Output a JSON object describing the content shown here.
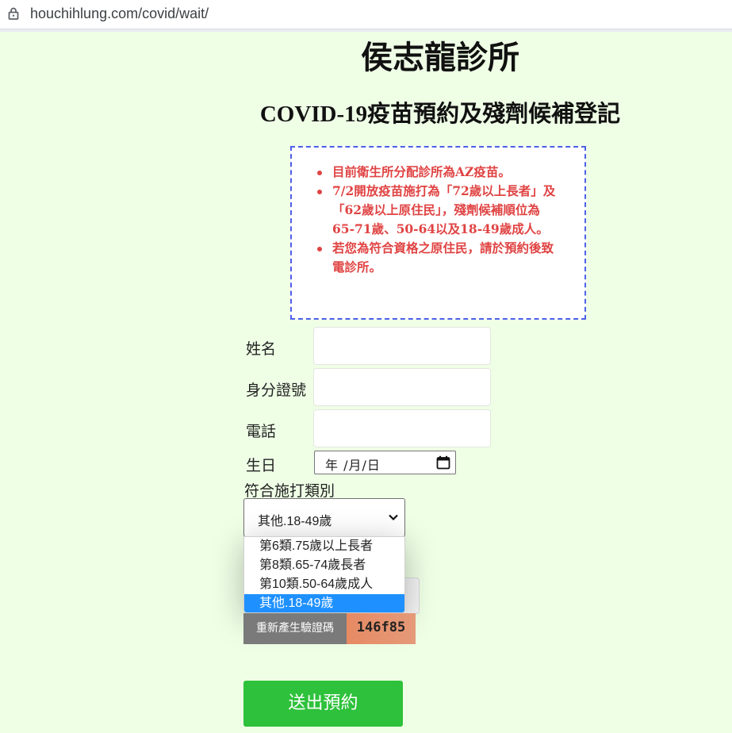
{
  "browser": {
    "url": "houchihlung.com/covid/wait/"
  },
  "header": {
    "clinic_name": "侯志龍診所",
    "subtitle": "COVID-19疫苗預約及殘劑候補登記"
  },
  "notice": {
    "items": [
      "目前衛生所分配診所為AZ疫苗。",
      "7/2開放疫苗施打為「72歲以上長者」及「62歲以上原住民」，殘劑候補順位為65-71歲、50-64以及18-49歲成人。",
      "若您為符合資格之原住民，請於預約後致電診所。"
    ]
  },
  "form": {
    "name_label": "姓名",
    "id_label": "身分證號",
    "phone_label": "電話",
    "birthday_label": "生日",
    "birthday_placeholder": "年 /月/日",
    "category_label": "符合施打類別",
    "category_selected": "其他.18-49歲",
    "category_options": [
      "第6類.75歲以上長者",
      "第8類.65-74歲長者",
      "第10類.50-64歲成人",
      "其他.18-49歲"
    ],
    "regenerate_captcha_label": "重新產生驗證碼",
    "captcha_code": "146f85",
    "submit_label": "送出預約"
  },
  "colors": {
    "page_background": "#efffe6",
    "notice_text": "#e04343",
    "notice_border": "#4d60e8",
    "submit_button": "#2ec13b",
    "selected_option": "#1e90ff"
  }
}
